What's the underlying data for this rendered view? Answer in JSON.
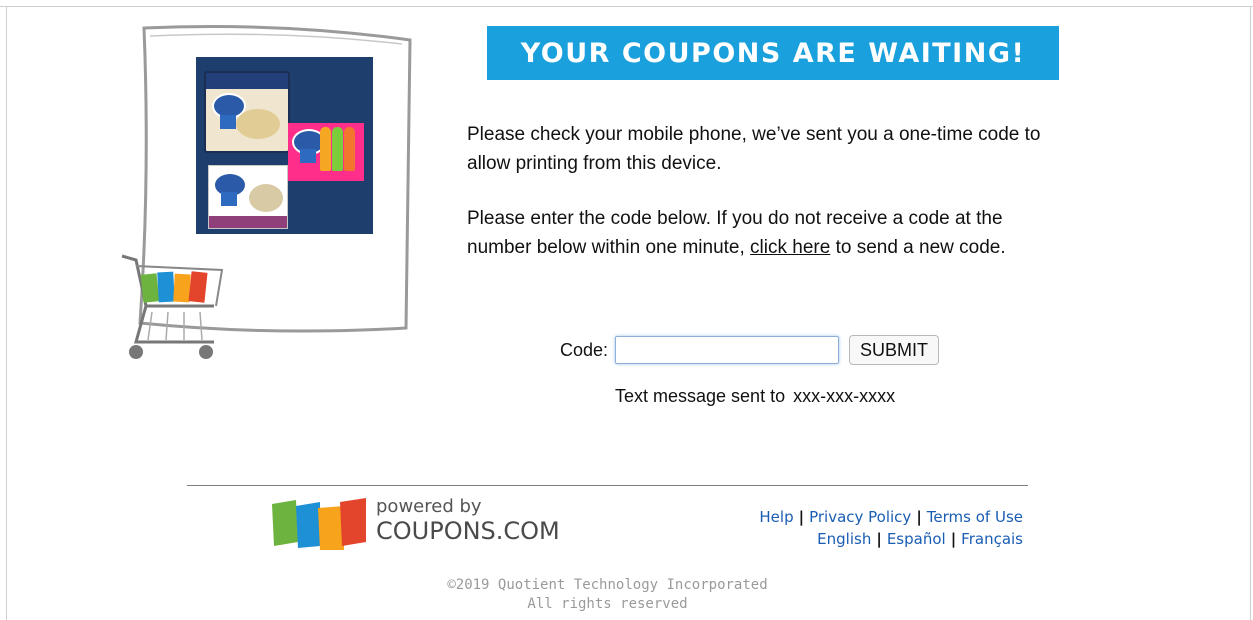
{
  "banner": {
    "title": "YOUR COUPONS ARE WAITING!"
  },
  "message": {
    "paragraph1": "Please check your mobile phone, we’ve sent you a one-time code to allow printing from this device.",
    "paragraph2_before": "Please enter the code below. If you do not receive a code at the number below within one minute,",
    "paragraph2_link": "click here",
    "paragraph2_after": "to send a new code."
  },
  "form": {
    "code_label": "Code:",
    "code_value": "",
    "submit_label": "SUBMIT",
    "sent_label": "Text message sent to",
    "sent_number": "xxx-xxx-xxxx"
  },
  "footer": {
    "powered_by": "powered by",
    "brand": "COUPONS.COM",
    "links_row1": [
      "Help",
      "Privacy Policy",
      "Terms of Use"
    ],
    "links_row2": [
      "English",
      "Español",
      "Français"
    ],
    "copyright_line1": "©2019 Quotient Technology Incorporated",
    "copyright_line2": "All rights reserved"
  },
  "colors": {
    "banner": "#1aa0dc",
    "link": "#1a5db3"
  },
  "icons": {
    "cart": "shopping-cart-icon",
    "brand_logo": "coupons-logo-icon"
  }
}
